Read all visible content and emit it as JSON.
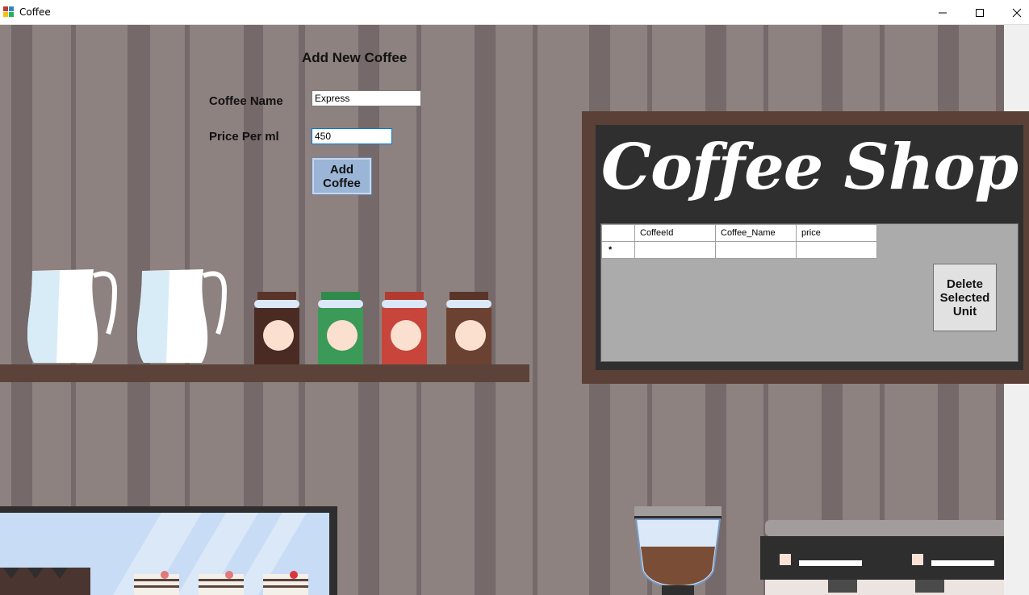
{
  "window": {
    "title": "Coffee",
    "minimize_icon": "minimize-icon",
    "maximize_icon": "maximize-icon",
    "close_icon": "close-icon"
  },
  "form": {
    "heading": "Add New Coffee",
    "coffee_name_label": "Coffee Name",
    "coffee_name_value": "Express",
    "price_label": "Price Per ml",
    "price_value": "450",
    "add_button_line1": "Add",
    "add_button_line2": "Coffee"
  },
  "board": {
    "title": "Coffee Shop"
  },
  "grid": {
    "columns": [
      "CoffeeId",
      "Coffee_Name",
      "price"
    ],
    "new_row_marker": "*"
  },
  "delete_button": {
    "line1": "Delete",
    "line2": "Selected",
    "line3": "Unit"
  },
  "colors": {
    "wall": "#8d827f",
    "shelf": "#5c433a",
    "board": "#2f2f2f",
    "add_button": "#9bb5d6"
  }
}
